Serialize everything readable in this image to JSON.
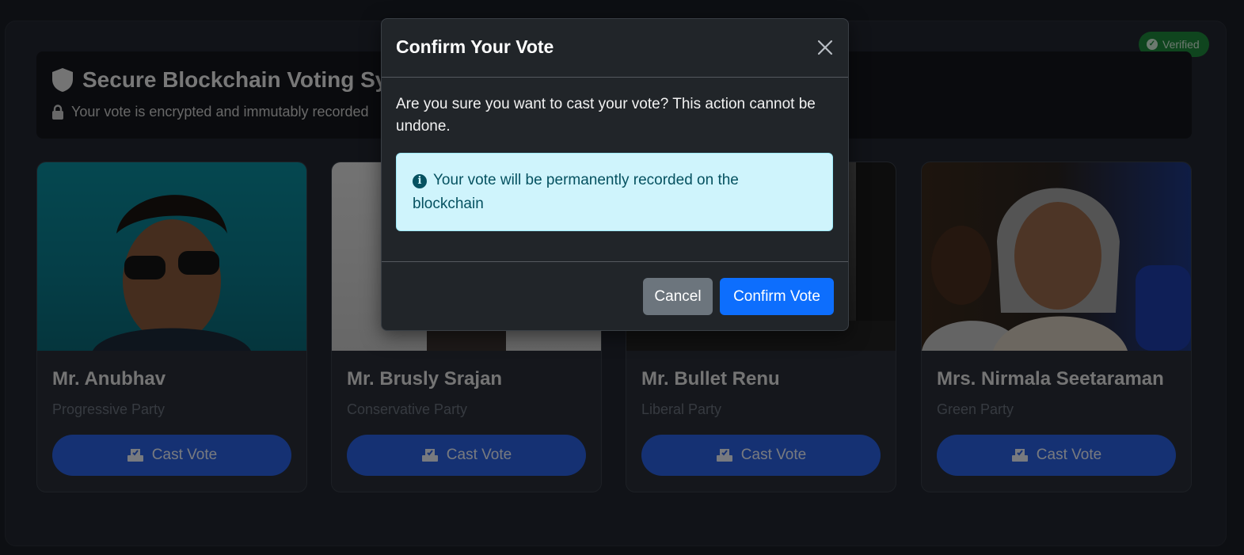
{
  "badge": {
    "label": "Verified",
    "icon": "check-circle-icon",
    "color": "#1f8a3d"
  },
  "header": {
    "title": "Secure Blockchain Voting System",
    "title_icon": "shield-icon",
    "subtitle": "Your vote is encrypted and immutably recorded",
    "subtitle_icon": "lock-icon"
  },
  "candidates": [
    {
      "name": "Mr. Anubhav",
      "party": "Progressive Party",
      "button": "Cast Vote"
    },
    {
      "name": "Mr. Brusly Srajan",
      "party": "Conservative Party",
      "button": "Cast Vote"
    },
    {
      "name": "Mr. Bullet Renu",
      "party": "Liberal Party",
      "button": "Cast Vote"
    },
    {
      "name": "Mrs. Nirmala Seetaraman",
      "party": "Green Party",
      "button": "Cast Vote"
    }
  ],
  "modal": {
    "title": "Confirm Your Vote",
    "message": "Are you sure you want to cast your vote? This action cannot be undone.",
    "alert": "Your vote will be permanently recorded on the blockchain",
    "alert_icon": "info-icon",
    "cancel_label": "Cancel",
    "confirm_label": "Confirm Vote"
  },
  "colors": {
    "primary": "#0d6efd",
    "secondary": "#6c757d",
    "info_bg": "#cff4fc",
    "info_text": "#055160"
  }
}
